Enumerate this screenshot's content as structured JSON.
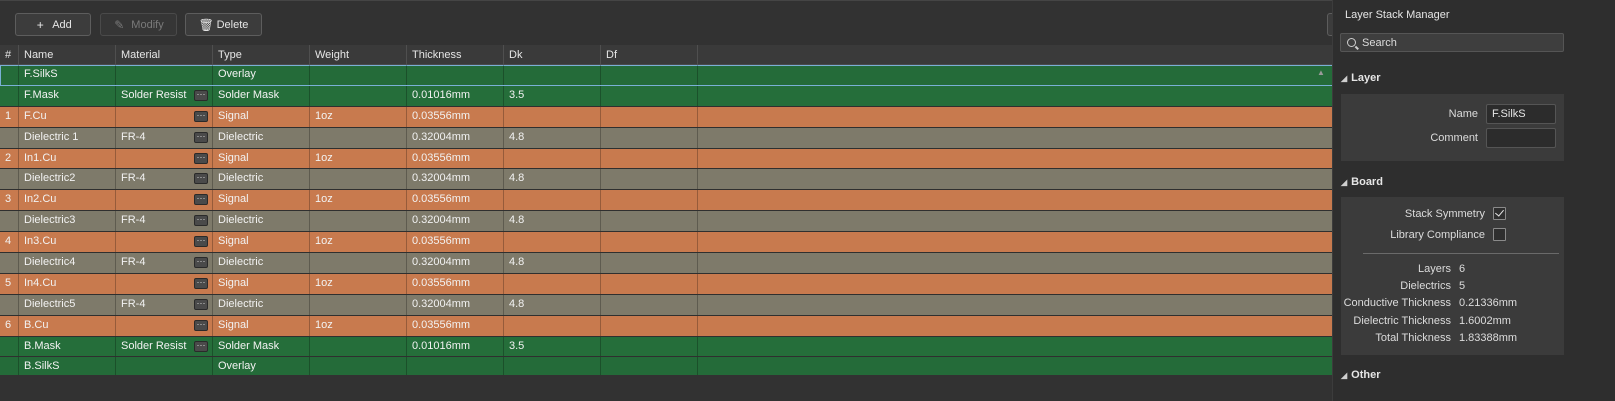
{
  "toolbar": {
    "add_label": "Add",
    "modify_label": "Modify",
    "delete_label": "Delete"
  },
  "table": {
    "headers": [
      "#",
      "Name",
      "Material",
      "Type",
      "Weight",
      "Thickness",
      "Dk",
      "Df"
    ],
    "rows": [
      {
        "num": "",
        "name": "F.SilkS",
        "material": "",
        "type": "Overlay",
        "weight": "",
        "thickness": "",
        "dk": "",
        "df": "",
        "kind": "overlay",
        "selected": true,
        "dots": false
      },
      {
        "num": "",
        "name": "F.Mask",
        "material": "Solder Resist",
        "type": "Solder Mask",
        "weight": "",
        "thickness": "0.01016mm",
        "dk": "3.5",
        "df": "",
        "kind": "mask",
        "selected": false,
        "dots": true
      },
      {
        "num": "1",
        "name": "F.Cu",
        "material": "",
        "type": "Signal",
        "weight": "1oz",
        "thickness": "0.03556mm",
        "dk": "",
        "df": "",
        "kind": "signal",
        "selected": false,
        "dots": true
      },
      {
        "num": "",
        "name": "Dielectric 1",
        "material": "FR-4",
        "type": "Dielectric",
        "weight": "",
        "thickness": "0.32004mm",
        "dk": "4.8",
        "df": "",
        "kind": "dielectric",
        "selected": false,
        "dots": true
      },
      {
        "num": "2",
        "name": "In1.Cu",
        "material": "",
        "type": "Signal",
        "weight": "1oz",
        "thickness": "0.03556mm",
        "dk": "",
        "df": "",
        "kind": "signal",
        "selected": false,
        "dots": true
      },
      {
        "num": "",
        "name": "Dielectric2",
        "material": "FR-4",
        "type": "Dielectric",
        "weight": "",
        "thickness": "0.32004mm",
        "dk": "4.8",
        "df": "",
        "kind": "dielectric",
        "selected": false,
        "dots": true
      },
      {
        "num": "3",
        "name": "In2.Cu",
        "material": "",
        "type": "Signal",
        "weight": "1oz",
        "thickness": "0.03556mm",
        "dk": "",
        "df": "",
        "kind": "signal",
        "selected": false,
        "dots": true
      },
      {
        "num": "",
        "name": "Dielectric3",
        "material": "FR-4",
        "type": "Dielectric",
        "weight": "",
        "thickness": "0.32004mm",
        "dk": "4.8",
        "df": "",
        "kind": "dielectric",
        "selected": false,
        "dots": true
      },
      {
        "num": "4",
        "name": "In3.Cu",
        "material": "",
        "type": "Signal",
        "weight": "1oz",
        "thickness": "0.03556mm",
        "dk": "",
        "df": "",
        "kind": "signal",
        "selected": false,
        "dots": true
      },
      {
        "num": "",
        "name": "Dielectric4",
        "material": "FR-4",
        "type": "Dielectric",
        "weight": "",
        "thickness": "0.32004mm",
        "dk": "4.8",
        "df": "",
        "kind": "dielectric",
        "selected": false,
        "dots": true
      },
      {
        "num": "5",
        "name": "In4.Cu",
        "material": "",
        "type": "Signal",
        "weight": "1oz",
        "thickness": "0.03556mm",
        "dk": "",
        "df": "",
        "kind": "signal",
        "selected": false,
        "dots": true
      },
      {
        "num": "",
        "name": "Dielectric5",
        "material": "FR-4",
        "type": "Dielectric",
        "weight": "",
        "thickness": "0.32004mm",
        "dk": "4.8",
        "df": "",
        "kind": "dielectric",
        "selected": false,
        "dots": true
      },
      {
        "num": "6",
        "name": "B.Cu",
        "material": "",
        "type": "Signal",
        "weight": "1oz",
        "thickness": "0.03556mm",
        "dk": "",
        "df": "",
        "kind": "signal",
        "selected": false,
        "dots": true
      },
      {
        "num": "",
        "name": "B.Mask",
        "material": "Solder Resist",
        "type": "Solder Mask",
        "weight": "",
        "thickness": "0.01016mm",
        "dk": "3.5",
        "df": "",
        "kind": "mask",
        "selected": false,
        "dots": true
      },
      {
        "num": "",
        "name": "B.SilkS",
        "material": "",
        "type": "Overlay",
        "weight": "",
        "thickness": "",
        "dk": "",
        "df": "",
        "kind": "overlay",
        "selected": false,
        "dots": false
      }
    ]
  },
  "panel": {
    "title": "Layer Stack Manager",
    "search_placeholder": "Search",
    "layer_section": {
      "heading": "Layer",
      "name_label": "Name",
      "name_value": "F.SilkS",
      "comment_label": "Comment",
      "comment_value": ""
    },
    "board_section": {
      "heading": "Board",
      "stack_symmetry_label": "Stack Symmetry",
      "stack_symmetry_checked": true,
      "library_compliance_label": "Library Compliance",
      "library_compliance_checked": false,
      "stats": [
        {
          "label": "Layers",
          "value": "6"
        },
        {
          "label": "Dielectrics",
          "value": "5"
        },
        {
          "label": "Conductive Thickness",
          "value": "0.21336mm"
        },
        {
          "label": "Dielectric Thickness",
          "value": "1.6002mm"
        },
        {
          "label": "Total Thickness",
          "value": "1.83388mm"
        }
      ]
    },
    "other_section": {
      "heading": "Other"
    }
  },
  "icons": {
    "add": "plus-icon",
    "modify": "pencil-icon",
    "delete": "trash-icon",
    "menu": "hamburger-menu-icon",
    "search": "search-icon",
    "collapse": "triangle-down-icon",
    "ellipsis": "ellipsis-icon"
  },
  "colors": {
    "overlay": "#246b39",
    "mask": "#256e3a",
    "signal": "#c87a4e",
    "dielectric": "#7e7a6a",
    "selection": "#7ab0d6"
  }
}
